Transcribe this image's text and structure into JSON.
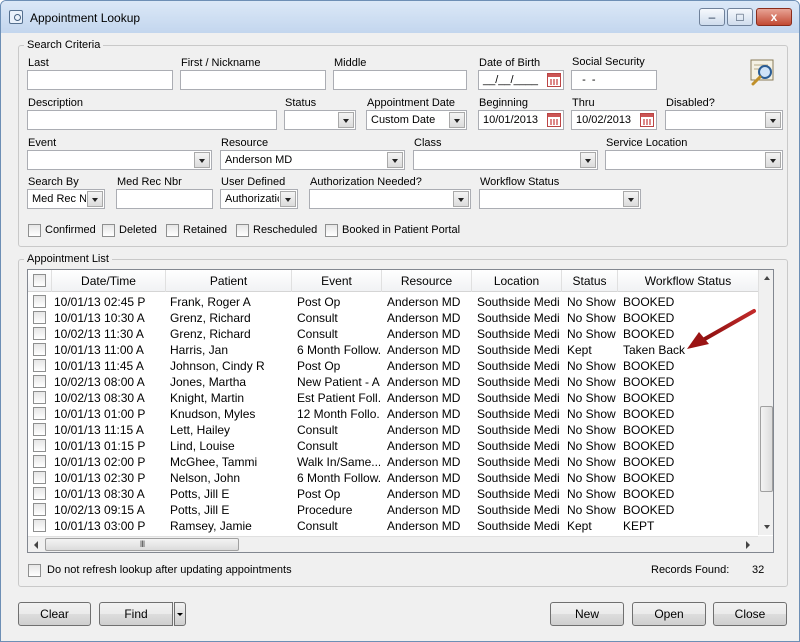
{
  "window": {
    "title": "Appointment Lookup",
    "minimize_glyph": "–",
    "maximize_glyph": "□",
    "close_glyph": "x",
    "icon": "magnifier-icon"
  },
  "criteria": {
    "group_title": "Search Criteria",
    "last_label": "Last",
    "first_label": "First / Nickname",
    "middle_label": "Middle",
    "dob_label": "Date of Birth",
    "dob_value": "__/__/____",
    "ssn_label": "Social Security",
    "ssn_value": "  -  -",
    "description_label": "Description",
    "status_label": "Status",
    "appt_date_label": "Appointment Date",
    "appt_date_value": "Custom Date",
    "beginning_label": "Beginning",
    "beginning_value": "10/01/2013",
    "thru_label": "Thru",
    "thru_value": "10/02/2013",
    "disabled_label": "Disabled?",
    "event_label": "Event",
    "resource_label": "Resource",
    "resource_value": "Anderson MD",
    "class_label": "Class",
    "service_location_label": "Service Location",
    "search_by_label": "Search By",
    "search_by_value": "Med Rec Nbr",
    "med_rec_label": "Med Rec Nbr",
    "user_defined_label": "User Defined",
    "user_defined_value": "Authorization",
    "auth_needed_label": "Authorization Needed?",
    "workflow_status_label": "Workflow Status",
    "confirmed_label": "Confirmed",
    "deleted_label": "Deleted",
    "retained_label": "Retained",
    "rescheduled_label": "Rescheduled",
    "booked_portal_label": "Booked in Patient Portal"
  },
  "list": {
    "group_title": "Appointment List",
    "columns": [
      "Date/Time",
      "Patient",
      "Event",
      "Resource",
      "Location",
      "Status",
      "Workflow Status"
    ],
    "rows": [
      [
        "10/01/13 02:45 P",
        "Frank, Roger A",
        "Post Op",
        "Anderson MD",
        "Southside Medi...",
        "No Show",
        "BOOKED"
      ],
      [
        "10/01/13 10:30 A",
        "Grenz, Richard",
        "Consult",
        "Anderson MD",
        "Southside Medi...",
        "No Show",
        "BOOKED"
      ],
      [
        "10/02/13 11:30 A",
        "Grenz, Richard",
        "Consult",
        "Anderson MD",
        "Southside Medi...",
        "No Show",
        "BOOKED"
      ],
      [
        "10/01/13 11:00 A",
        "Harris, Jan",
        "6 Month Follow...",
        "Anderson MD",
        "Southside Medi...",
        "Kept",
        "Taken Back"
      ],
      [
        "10/01/13 11:45 A",
        "Johnson, Cindy R",
        "Post Op",
        "Anderson MD",
        "Southside Medi...",
        "No Show",
        "BOOKED"
      ],
      [
        "10/02/13 08:00 A",
        "Jones, Martha",
        "New Patient - A...",
        "Anderson MD",
        "Southside Medi...",
        "No Show",
        "BOOKED"
      ],
      [
        "10/02/13 08:30 A",
        "Knight, Martin",
        "Est Patient Foll...",
        "Anderson MD",
        "Southside Medi...",
        "No Show",
        "BOOKED"
      ],
      [
        "10/01/13 01:00 P",
        "Knudson, Myles",
        "12 Month Follo...",
        "Anderson MD",
        "Southside Medi...",
        "No Show",
        "BOOKED"
      ],
      [
        "10/01/13 11:15 A",
        "Lett, Hailey",
        "Consult",
        "Anderson MD",
        "Southside Medi...",
        "No Show",
        "BOOKED"
      ],
      [
        "10/01/13 01:15 P",
        "Lind, Louise",
        "Consult",
        "Anderson MD",
        "Southside Medi...",
        "No Show",
        "BOOKED"
      ],
      [
        "10/01/13 02:00 P",
        "McGhee, Tammi",
        "Walk In/Same...",
        "Anderson MD",
        "Southside Medi...",
        "No Show",
        "BOOKED"
      ],
      [
        "10/01/13 02:30 P",
        "Nelson, John",
        "6 Month Follow...",
        "Anderson MD",
        "Southside Medi...",
        "No Show",
        "BOOKED"
      ],
      [
        "10/01/13 08:30 A",
        "Potts, Jill E",
        "Post Op",
        "Anderson MD",
        "Southside Medi...",
        "No Show",
        "BOOKED"
      ],
      [
        "10/02/13 09:15 A",
        "Potts, Jill E",
        "Procedure",
        "Anderson MD",
        "Southside Medi...",
        "No Show",
        "BOOKED"
      ],
      [
        "10/01/13 03:00 P",
        "Ramsey, Jamie",
        "Consult",
        "Anderson MD",
        "Southside Medi...",
        "Kept",
        "KEPT"
      ]
    ],
    "hscroll_grip": "III",
    "annotation": "red-arrow-icon"
  },
  "footer": {
    "no_refresh_label": "Do not refresh lookup after updating appointments",
    "records_label": "Records Found:",
    "records_value": "32"
  },
  "buttons": {
    "clear": "Clear",
    "find": "Find",
    "new": "New",
    "open": "Open",
    "close": "Close"
  },
  "colors": {
    "arrow": "#b01c1c",
    "title_bar": "#c3d6ee",
    "close_button": "#c24a33"
  }
}
